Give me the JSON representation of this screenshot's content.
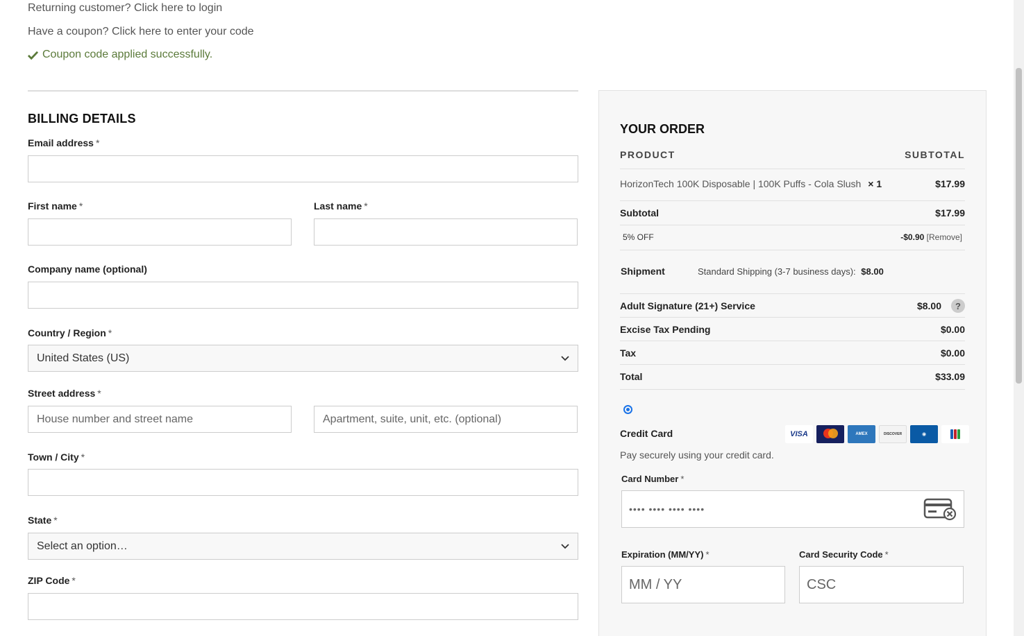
{
  "notices": {
    "returning_prefix": "Returning customer?",
    "returning_link": "Click here to login",
    "coupon_prefix": "Have a coupon?",
    "coupon_link": "Click here to enter your code",
    "coupon_success": "Coupon code applied successfully."
  },
  "billing": {
    "title": "BILLING DETAILS",
    "required_mark": "*",
    "email_label": "Email address",
    "first_name_label": "First name",
    "last_name_label": "Last name",
    "company_label": "Company name (optional)",
    "country_label": "Country / Region",
    "country_value": "United States (US)",
    "street_label": "Street address",
    "street_placeholder": "House number and street name",
    "street2_placeholder": "Apartment, suite, unit, etc. (optional)",
    "city_label": "Town / City",
    "state_label": "State",
    "state_value": "Select an option…",
    "zip_label": "ZIP Code"
  },
  "order": {
    "title": "YOUR ORDER",
    "col_product": "PRODUCT",
    "col_subtotal": "SUBTOTAL",
    "item_name": "HorizonTech 100K Disposable | 100K Puffs - Cola Slush",
    "item_qty": "× 1",
    "item_price": "$17.99",
    "subtotal_label": "Subtotal",
    "subtotal_value": "$17.99",
    "discount_label": "5% OFF",
    "discount_value": "-$0.90",
    "discount_remove": "[Remove]",
    "shipment_label": "Shipment",
    "shipment_method": "Standard Shipping (3-7 business days):",
    "shipment_price": "$8.00",
    "signature_label": "Adult Signature (21+) Service",
    "signature_value": "$8.00",
    "help_glyph": "?",
    "excise_label": "Excise Tax Pending",
    "excise_value": "$0.00",
    "tax_label": "Tax",
    "tax_value": "$0.00",
    "total_label": "Total",
    "total_value": "$33.09"
  },
  "payment": {
    "method_label": "Credit Card",
    "description": "Pay securely using your credit card.",
    "card_brands": [
      "VISA",
      "mastercard",
      "AMERICAN EXPRESS",
      "DISCOVER",
      "Diners Club",
      "JCB"
    ],
    "card_number_label": "Card Number",
    "card_number_placeholder": "•••• •••• •••• ••••",
    "expiry_label": "Expiration (MM/YY)",
    "expiry_placeholder": "MM / YY",
    "csc_label": "Card Security Code",
    "csc_placeholder": "CSC"
  },
  "colors": {
    "success": "#5b7a3a",
    "radio": "#1a73e8",
    "panel_bg": "#f7f7f7"
  }
}
